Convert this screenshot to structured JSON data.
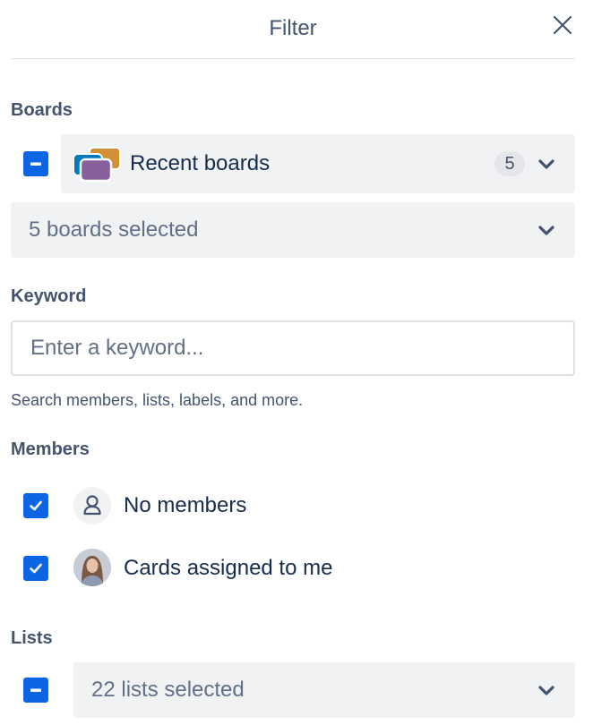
{
  "header": {
    "title": "Filter",
    "close_icon": "close-icon"
  },
  "boards": {
    "label": "Boards",
    "checkbox_state": "indeterminate",
    "recent": {
      "label": "Recent boards",
      "count": "5",
      "icon": "boards-stack-icon",
      "colors": [
        "#0079bf",
        "#d29034",
        "#89609e"
      ]
    },
    "selector": {
      "value": "5 boards selected"
    }
  },
  "keyword": {
    "label": "Keyword",
    "placeholder": "Enter a keyword...",
    "value": "",
    "helper": "Search members, lists, labels, and more."
  },
  "members": {
    "label": "Members",
    "items": [
      {
        "label": "No members",
        "checked": true,
        "avatar": "person-icon"
      },
      {
        "label": "Cards assigned to me",
        "checked": true,
        "avatar": "user-photo"
      }
    ]
  },
  "lists": {
    "label": "Lists",
    "checkbox_state": "indeterminate",
    "selector": {
      "value": "22 lists selected"
    }
  },
  "colors": {
    "accent": "#0c66e4",
    "select_bg": "#f1f2f4",
    "text": "#172b4d",
    "subtle_text": "#44546f"
  }
}
